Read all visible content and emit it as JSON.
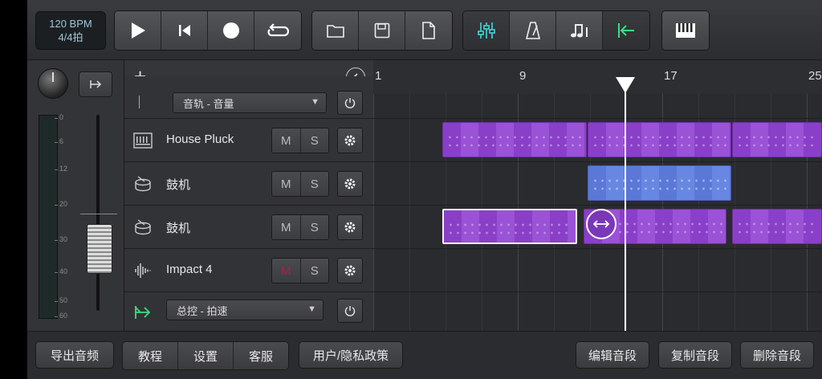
{
  "transport": {
    "bpm": "120 BPM",
    "time_sig": "4/4拍"
  },
  "colors": {
    "accent_cyan": "#3ec9c9",
    "accent_green": "#3ddc84",
    "clip_purple": "#9a52d6",
    "clip_blue": "#6887e2",
    "mute_red": "#b02040"
  },
  "toolbar": {
    "transport_icons": [
      "play-icon",
      "skip-back-icon",
      "record-icon",
      "loop-icon"
    ],
    "file_icons": [
      "folder-icon",
      "save-icon",
      "new-file-icon"
    ],
    "view_icons": [
      "mixer-icon",
      "metronome-icon",
      "notes-icon",
      "snap-left-icon"
    ],
    "piano_icon": "piano-keyboard-icon"
  },
  "mixer": {
    "scale": [
      "0",
      "6",
      "12",
      "20",
      "30",
      "40",
      "50",
      "60"
    ]
  },
  "ruler": {
    "marks": [
      "1",
      "9",
      "17",
      "25"
    ]
  },
  "tracks": {
    "partial_dropdown": "音轨 - 音量",
    "rows": [
      {
        "name": "House Pluck",
        "icon": "keyboard-icon",
        "mute": "M",
        "solo": "S"
      },
      {
        "name": "鼓机",
        "icon": "drum-icon",
        "mute": "M",
        "solo": "S"
      },
      {
        "name": "鼓机",
        "icon": "drum-icon",
        "mute": "M",
        "solo": "S"
      },
      {
        "name": "Impact 4",
        "icon": "waveform-icon",
        "mute": "M",
        "solo": "S"
      }
    ],
    "master_dropdown": "总控 - 拍速"
  },
  "bottom": {
    "export": "导出音频",
    "tutorial": "教程",
    "settings": "设置",
    "support": "客服",
    "privacy": "用户/隐私政策",
    "edit_clip": "编辑音段",
    "copy_clip": "复制音段",
    "delete_clip": "删除音段"
  }
}
